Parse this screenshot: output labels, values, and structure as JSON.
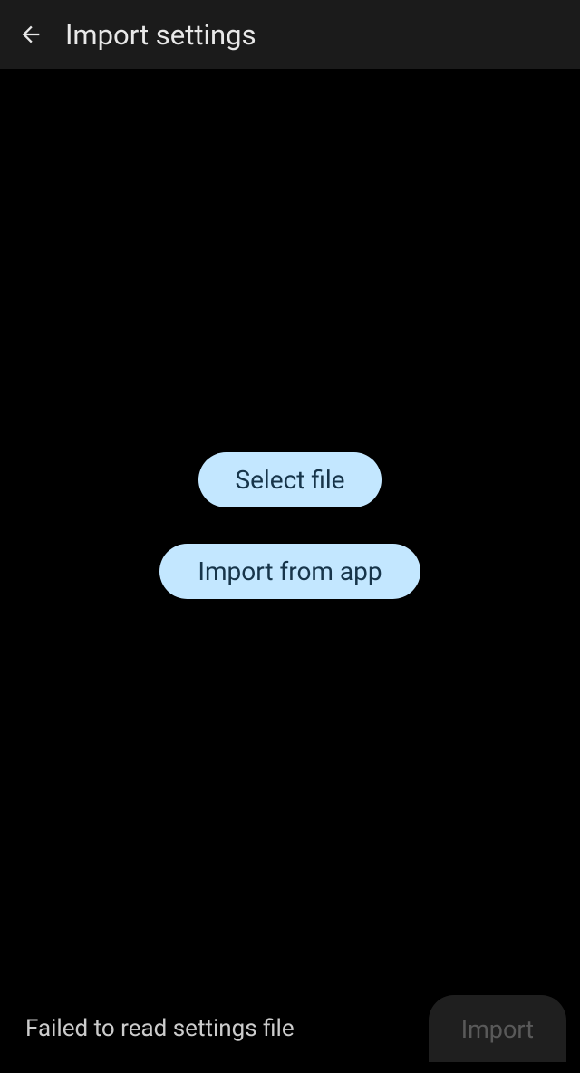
{
  "header": {
    "title": "Import settings"
  },
  "buttons": {
    "select_file": "Select file",
    "import_from_app": "Import from app",
    "import": "Import"
  },
  "status": {
    "message": "Failed to read settings file"
  }
}
